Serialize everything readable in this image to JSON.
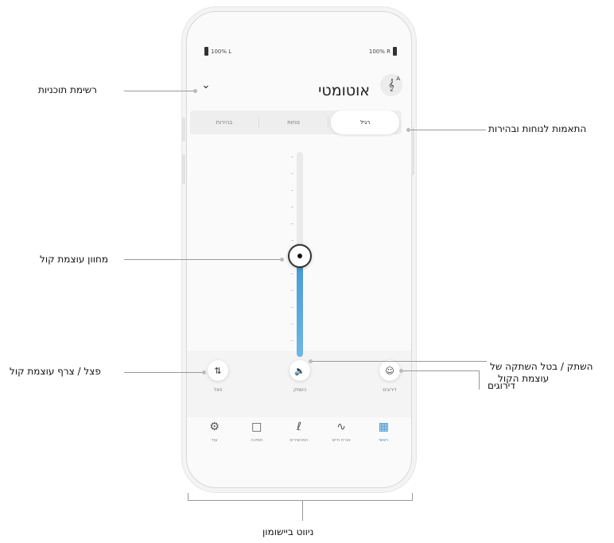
{
  "status": {
    "left_battery": "100% L",
    "right_battery": "100% R"
  },
  "header": {
    "title": "אוטומטי",
    "program_icon": "ear-icon",
    "program_icon_sup": "A",
    "menu_icon": "chevron-down-icon"
  },
  "tabs": [
    {
      "label": "רגיל",
      "active": true
    },
    {
      "label": "נוחות",
      "active": false
    },
    {
      "label": "בהירות",
      "active": false
    }
  ],
  "volume": {
    "level": 0.45
  },
  "actions": {
    "remote": {
      "label": "דירוגים",
      "icon": "smiley-icon"
    },
    "mute": {
      "label": "השתק",
      "icon": "speaker-icon"
    },
    "split": {
      "label": "פצל",
      "icon": "split-arrows-icon"
    }
  },
  "nav": [
    {
      "label": "ראשי",
      "icon": "grid-icon",
      "active": true
    },
    {
      "label": "אורח חיים",
      "icon": "activity-icon",
      "active": false
    },
    {
      "label": "המכשירים",
      "icon": "hearing-aid-icon",
      "active": false
    },
    {
      "label": "תמיכה",
      "icon": "chat-icon",
      "active": false
    },
    {
      "label": "עוד",
      "icon": "gear-icon",
      "active": false
    }
  ],
  "callouts": {
    "programs": "רשימת תוכניות",
    "adjust": "התאמות לנוחות ובהירות",
    "volume": "מחוון עוצמת קול",
    "split": "פצל / צרף עוצמת קול",
    "mute_line1": "השתק / בטל השתקה של",
    "mute_line2": "עוצמת הקול",
    "ratings": "דירוגים",
    "nav": "ניווט ביישומון"
  },
  "colors": {
    "accent": "#3a8fd0",
    "volume_fill": "#4a9ad4"
  }
}
